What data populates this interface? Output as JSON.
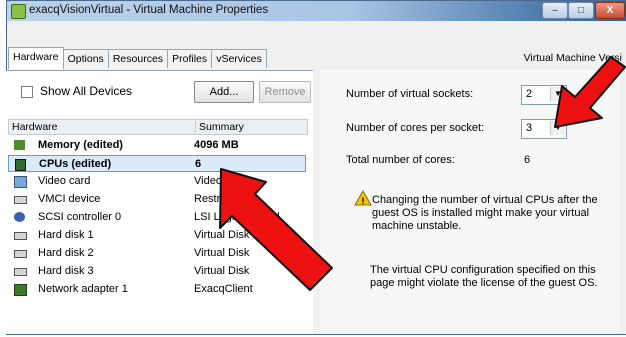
{
  "window": {
    "title": "exacqVisionVirtual - Virtual Machine Properties",
    "minimize_label": "–",
    "maximize_label": "□",
    "close_label": "X"
  },
  "tabs": [
    {
      "label": "Hardware",
      "active": true
    },
    {
      "label": "Options",
      "active": false
    },
    {
      "label": "Resources",
      "active": false
    },
    {
      "label": "Profiles",
      "active": false
    },
    {
      "label": "vServices",
      "active": false
    }
  ],
  "vm_version_label": "Virtual Machine Versi",
  "left": {
    "show_all_devices_label": "Show All Devices",
    "add_button": "Add...",
    "remove_button": "Remove",
    "columns": {
      "hardware": "Hardware",
      "summary": "Summary"
    },
    "rows": [
      {
        "icon": "memory-icon",
        "hardware": "Memory (edited)",
        "summary": "4096 MB",
        "bold": true,
        "selected": false
      },
      {
        "icon": "cpu-icon",
        "hardware": "CPUs (edited)",
        "summary": "6",
        "bold": true,
        "selected": true
      },
      {
        "icon": "monitor-icon",
        "hardware": "Video card",
        "summary": "Video card",
        "bold": false,
        "selected": false
      },
      {
        "icon": "device-icon",
        "hardware": "VMCI device",
        "summary": "Restricted",
        "bold": false,
        "selected": false
      },
      {
        "icon": "scsi-icon",
        "hardware": "SCSI controller 0",
        "summary": "LSI Logic Parallel",
        "bold": false,
        "selected": false
      },
      {
        "icon": "disk-icon",
        "hardware": "Hard disk 1",
        "summary": "Virtual Disk",
        "bold": false,
        "selected": false
      },
      {
        "icon": "disk-icon",
        "hardware": "Hard disk 2",
        "summary": "Virtual Disk",
        "bold": false,
        "selected": false
      },
      {
        "icon": "disk-icon",
        "hardware": "Hard disk 3",
        "summary": "Virtual Disk",
        "bold": false,
        "selected": false
      },
      {
        "icon": "network-icon",
        "hardware": "Network adapter 1",
        "summary": "ExacqClient",
        "bold": false,
        "selected": false
      }
    ]
  },
  "right": {
    "sockets_label": "Number of virtual sockets:",
    "sockets_value": "2",
    "cores_label": "Number of cores per socket:",
    "cores_value": "3",
    "total_label": "Total number of cores:",
    "total_value": "6",
    "warning_text": "Changing the number of virtual CPUs after the guest OS is installed might make your virtual machine unstable.",
    "license_note": "The virtual CPU configuration specified on this page might violate the license of the guest OS."
  },
  "colors": {
    "arrow_fill": "#ee1111",
    "arrow_stroke": "#111111",
    "selected_row": "#dbeaf9",
    "warning_icon": "#f4c20d"
  }
}
